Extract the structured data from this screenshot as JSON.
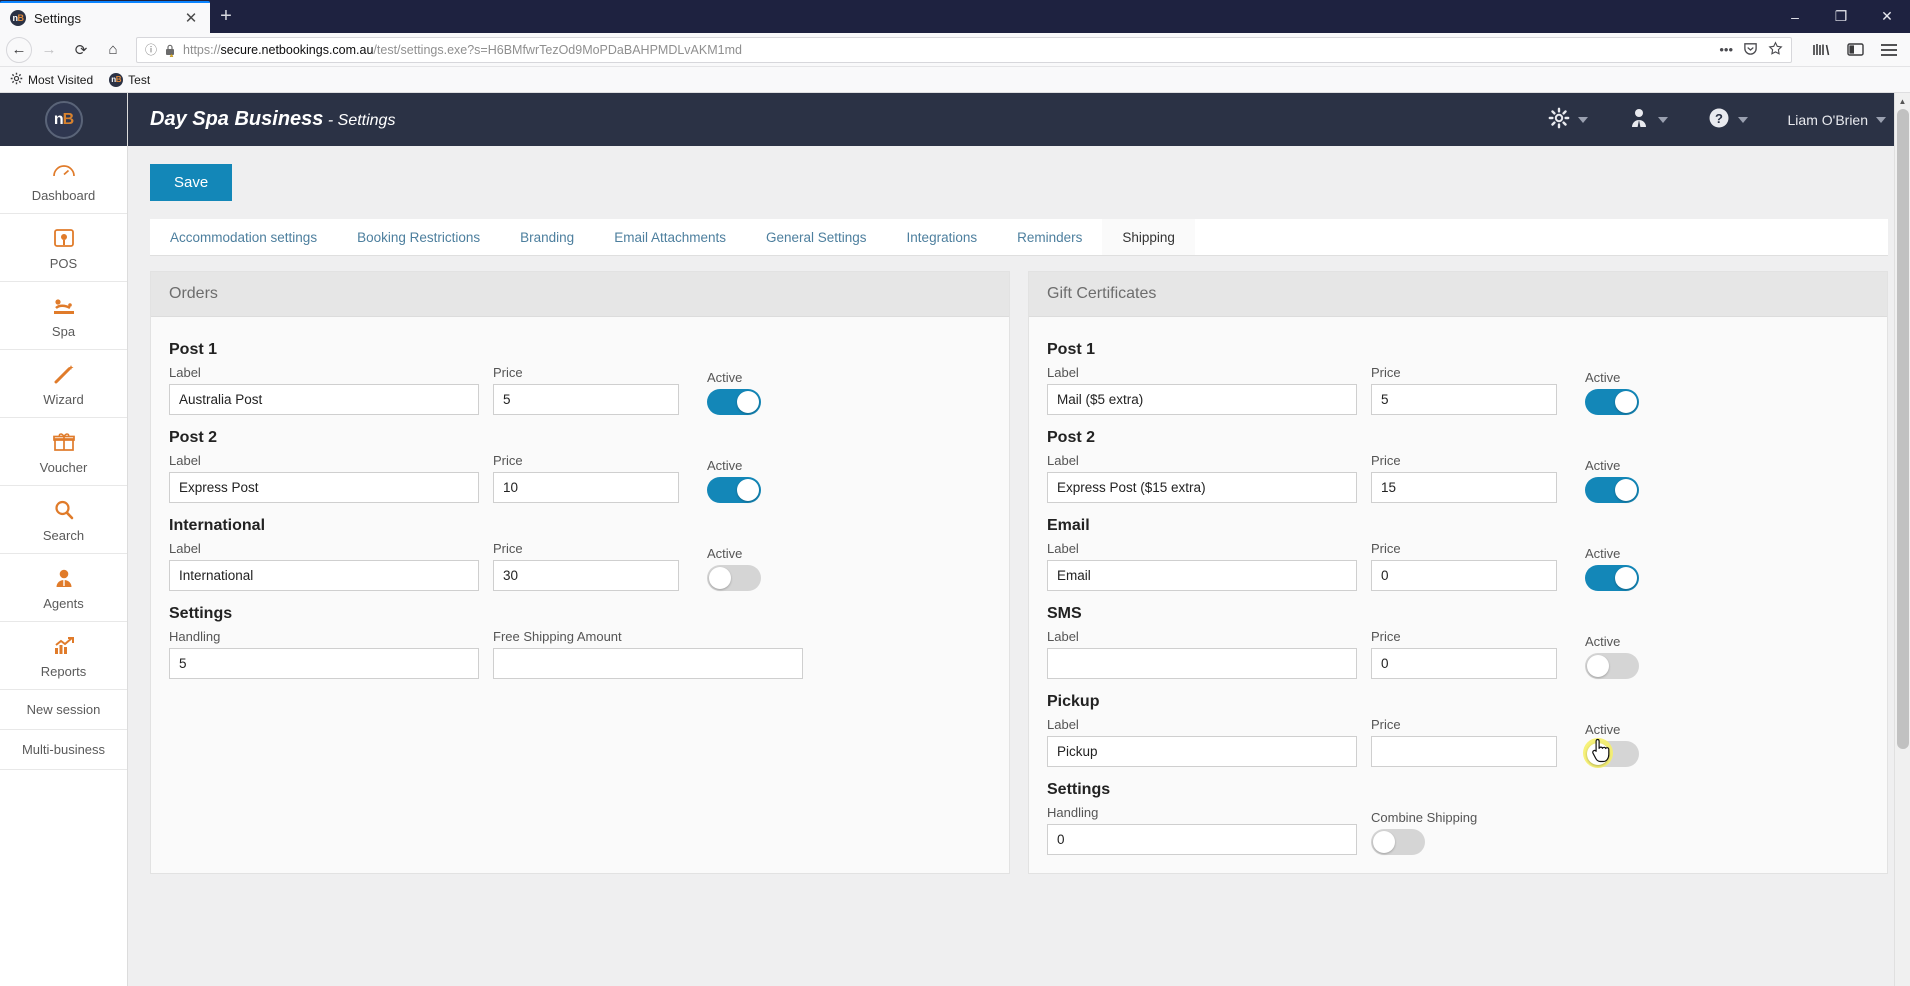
{
  "browser": {
    "tab": {
      "title": "Settings",
      "favicon": "nb-favicon",
      "close_label": "✕"
    },
    "newtab_label": "+",
    "window_controls": {
      "minimize": "–",
      "maximize": "❐",
      "close": "✕"
    },
    "nav": {
      "back": "←",
      "forward": "→",
      "reload": "⟳",
      "home": "⌂"
    },
    "url": {
      "scheme": "https://",
      "host": "secure.netbookings.com.au",
      "path": "/test/settings.exe?s=H6BMfwrTezOd9MoPDaBAHPMDLvAKM1md",
      "info_icon": "info-icon",
      "lock_warning_icon": "insecure-lock-icon"
    },
    "url_actions": {
      "more": "•••",
      "pocket": "pocket-icon",
      "bookmark": "star-icon"
    },
    "toolbar_right": {
      "library": "library-icon",
      "sidebar": "sidebar-icon",
      "menu": "hamburger-menu-icon"
    },
    "bookmarks": [
      {
        "label": "Most Visited",
        "icon": "gear-icon"
      },
      {
        "label": "Test",
        "icon": "nb-favicon"
      }
    ]
  },
  "sidebar": {
    "logo": {
      "primary": "n",
      "accent": "B"
    },
    "items": [
      {
        "label": "Dashboard",
        "icon": "dashboard-gauge-icon"
      },
      {
        "label": "POS",
        "icon": "pos-terminal-icon"
      },
      {
        "label": "Spa",
        "icon": "spa-massage-icon"
      },
      {
        "label": "Wizard",
        "icon": "magic-wand-icon"
      },
      {
        "label": "Voucher",
        "icon": "gift-icon"
      },
      {
        "label": "Search",
        "icon": "search-icon"
      },
      {
        "label": "Agents",
        "icon": "agent-person-icon"
      },
      {
        "label": "Reports",
        "icon": "reports-chart-icon"
      },
      {
        "label": "New session",
        "icon": null
      },
      {
        "label": "Multi-business",
        "icon": null
      }
    ]
  },
  "header": {
    "business_name": "Day Spa Business",
    "separator": " - ",
    "page_name": "Settings",
    "menu": [
      {
        "name": "settings-menu",
        "icon": "gear-icon",
        "label": ""
      },
      {
        "name": "user-menu",
        "icon": "user-tie-icon",
        "label": ""
      },
      {
        "name": "help-menu",
        "icon": "question-circle-icon",
        "label": ""
      },
      {
        "name": "account-menu",
        "icon": null,
        "label": "Liam O'Brien"
      }
    ]
  },
  "toolbar": {
    "save_label": "Save"
  },
  "tabs": [
    {
      "label": "Accommodation settings",
      "active": false
    },
    {
      "label": "Booking Restrictions",
      "active": false
    },
    {
      "label": "Branding",
      "active": false
    },
    {
      "label": "Email Attachments",
      "active": false
    },
    {
      "label": "General Settings",
      "active": false
    },
    {
      "label": "Integrations",
      "active": false
    },
    {
      "label": "Reminders",
      "active": false
    },
    {
      "label": "Shipping",
      "active": true
    }
  ],
  "field_headers": {
    "label": "Label",
    "price": "Price",
    "active": "Active"
  },
  "panels": {
    "orders": {
      "title": "Orders",
      "groups": [
        {
          "title": "Post 1",
          "label_value": "Australia Post",
          "price_value": "5",
          "active": true
        },
        {
          "title": "Post 2",
          "label_value": "Express Post",
          "price_value": "10",
          "active": true
        },
        {
          "title": "International",
          "label_value": "International",
          "price_value": "30",
          "active": false
        }
      ],
      "settings": {
        "title": "Settings",
        "handling_label": "Handling",
        "handling_value": "5",
        "free_shipping_label": "Free Shipping Amount",
        "free_shipping_value": ""
      }
    },
    "gift_certificates": {
      "title": "Gift Certificates",
      "groups": [
        {
          "title": "Post 1",
          "label_value": "Mail ($5 extra)",
          "price_value": "5",
          "active": true
        },
        {
          "title": "Post 2",
          "label_value": "Express Post ($15 extra)",
          "price_value": "15",
          "active": true
        },
        {
          "title": "Email",
          "label_value": "Email",
          "price_value": "0",
          "active": true
        },
        {
          "title": "SMS",
          "label_value": "",
          "price_value": "0",
          "active": false
        },
        {
          "title": "Pickup",
          "label_value": "Pickup",
          "price_value": "",
          "active": false,
          "highlight": true
        }
      ],
      "settings": {
        "title": "Settings",
        "handling_label": "Handling",
        "handling_value": "0",
        "combine_shipping_label": "Combine Shipping",
        "combine_shipping_active": false
      }
    }
  },
  "colors": {
    "accent_blue": "#1387b8",
    "brand_orange": "#e07b2a",
    "header_dark": "#2b3245",
    "click_highlight": "#f5f06a"
  }
}
